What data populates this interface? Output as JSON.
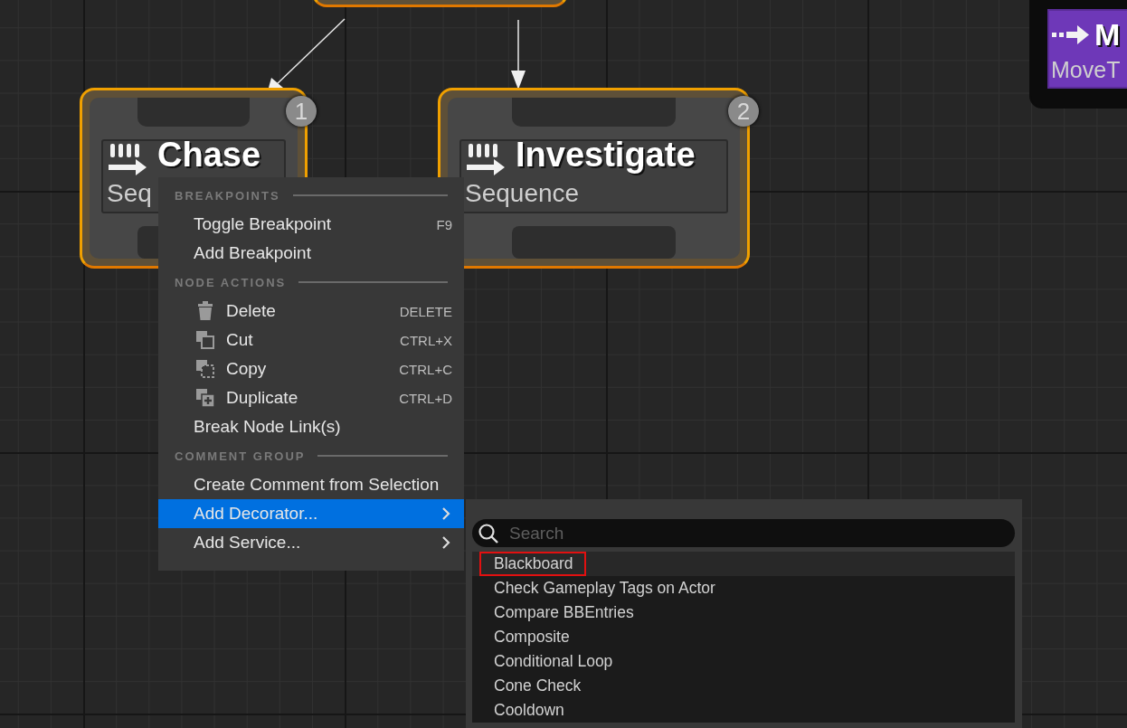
{
  "graph": {
    "nodes": [
      {
        "kind": "composite",
        "selected": true
      },
      {
        "kind": "composite",
        "title": "Chase",
        "subtitle": "Seq",
        "badge": "1",
        "selected": true
      },
      {
        "kind": "composite",
        "title": "Investigate",
        "subtitle": "Sequence",
        "badge": "2",
        "selected": true
      },
      {
        "kind": "task",
        "title": "M",
        "subtitle": "MoveT",
        "selected": false
      }
    ]
  },
  "context_menu": {
    "entries": [
      {
        "kind": "section",
        "label": "BREAKPOINTS"
      },
      {
        "kind": "item",
        "label": "Toggle Breakpoint",
        "shortcut": "F9",
        "submenu": false,
        "selected": false
      },
      {
        "kind": "item",
        "label": "Add Breakpoint",
        "submenu": false,
        "selected": false
      },
      {
        "kind": "section",
        "label": "NODE ACTIONS"
      },
      {
        "kind": "icon_item",
        "label": "Delete",
        "shortcut": "DELETE",
        "submenu": false,
        "selected": false
      },
      {
        "kind": "icon_item",
        "label": "Cut",
        "shortcut": "CTRL+X",
        "submenu": false,
        "selected": false
      },
      {
        "kind": "icon_item",
        "label": "Copy",
        "shortcut": "CTRL+C",
        "submenu": false,
        "selected": false
      },
      {
        "kind": "icon_item",
        "label": "Duplicate",
        "shortcut": "CTRL+D",
        "submenu": false,
        "selected": false
      },
      {
        "kind": "item",
        "label": "Break Node Link(s)",
        "submenu": false,
        "selected": false
      },
      {
        "kind": "section",
        "label": "COMMENT GROUP"
      },
      {
        "kind": "item",
        "label": "Create Comment from Selection",
        "submenu": false,
        "selected": false
      },
      {
        "kind": "item",
        "label": "Add Decorator...",
        "submenu": true,
        "selected": true
      },
      {
        "kind": "item",
        "label": "Add Service...",
        "submenu": true,
        "selected": false
      }
    ]
  },
  "submenu": {
    "search": {
      "placeholder": "Search"
    },
    "items": [
      {
        "label": "Blackboard",
        "selected": true,
        "outlined": true
      },
      {
        "label": "Check Gameplay Tags on Actor",
        "selected": false,
        "outlined": false
      },
      {
        "label": "Compare BBEntries",
        "selected": false,
        "outlined": false
      },
      {
        "label": "Composite",
        "selected": false,
        "outlined": false
      },
      {
        "label": "Conditional Loop",
        "selected": false,
        "outlined": false
      },
      {
        "label": "Cone Check",
        "selected": false,
        "outlined": false
      },
      {
        "label": "Cooldown",
        "selected": false,
        "outlined": false
      }
    ]
  }
}
